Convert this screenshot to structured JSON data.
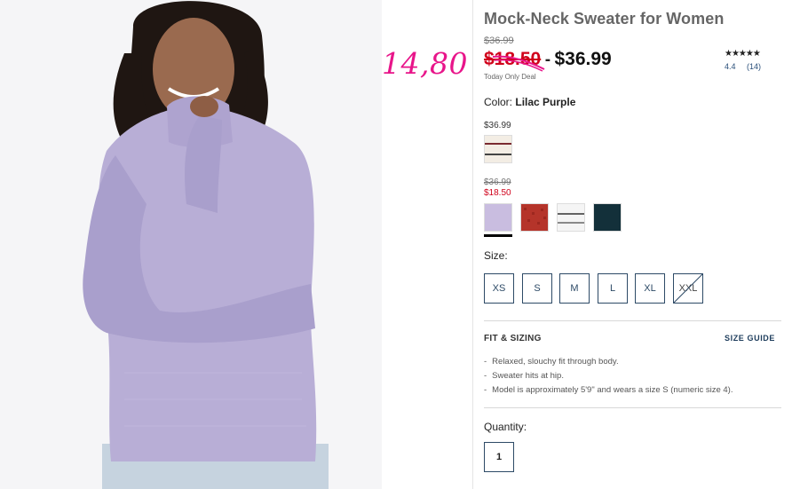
{
  "product": {
    "title": "Mock-Neck Sweater for Women",
    "original_price": "$36.99",
    "sale_price": "$18.50",
    "price_separator": "-",
    "regular_price": "$36.99",
    "deal_text": "Today Only Deal",
    "handwritten_price": "14,80"
  },
  "rating": {
    "stars": "★★★★★",
    "score": "4.4",
    "count": "(14)",
    "value": 4.4
  },
  "color": {
    "label": "Color:",
    "selected": "Lilac Purple",
    "group1_price": "$36.99",
    "group2_strike": "$36.99",
    "group2_sale": "$18.50",
    "swatches": [
      {
        "name": "cream-stripe",
        "color": "#f3ede4"
      },
      {
        "name": "lilac",
        "color": "#c9bde0"
      },
      {
        "name": "red-marled",
        "color": "#b5342a"
      },
      {
        "name": "white-stripe",
        "color": "#f5f5f5"
      },
      {
        "name": "dark-teal",
        "color": "#13303a"
      }
    ]
  },
  "size": {
    "label": "Size:",
    "options": [
      "XS",
      "S",
      "M",
      "L",
      "XL",
      "XXL"
    ]
  },
  "fit": {
    "heading": "FIT & SIZING",
    "guide_link": "SIZE GUIDE",
    "bullets": [
      "Relaxed, slouchy fit through body.",
      "Sweater hits at hip.",
      "Model is approximately 5'9\" and wears a size S (numeric size 4)."
    ]
  },
  "quantity": {
    "label": "Quantity:",
    "value": "1"
  },
  "colors": {
    "sale_red": "#d0021b",
    "handwriting_pink": "#e8158a",
    "accent_navy": "#2d4a66"
  }
}
